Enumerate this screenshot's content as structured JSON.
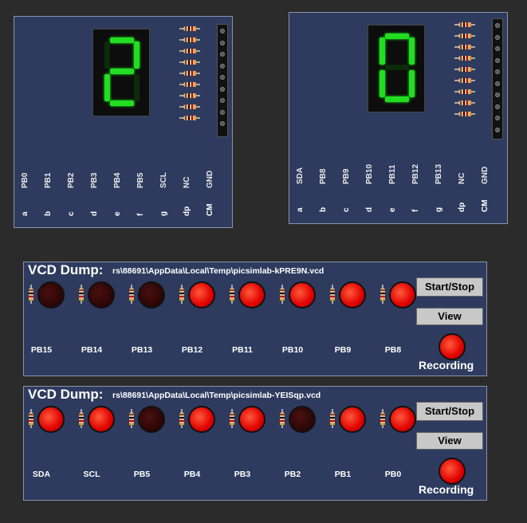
{
  "board1": {
    "digit": "2",
    "segments_on": [
      "a",
      "b",
      "g",
      "e",
      "d"
    ],
    "pin_letters": [
      "a",
      "b",
      "c",
      "d",
      "e",
      "f",
      "g",
      "dp",
      "CM"
    ],
    "pin_names": [
      "PB0",
      "PB1",
      "PB2",
      "PB3",
      "PB4",
      "PB5",
      "SCL",
      "NC",
      "GND"
    ]
  },
  "board2": {
    "digit": "0",
    "segments_on": [
      "a",
      "b",
      "c",
      "d",
      "e",
      "f"
    ],
    "pin_letters": [
      "a",
      "b",
      "c",
      "d",
      "e",
      "f",
      "g",
      "dp",
      "CM"
    ],
    "pin_names": [
      "SDA",
      "PB8",
      "PB9",
      "PB10",
      "PB11",
      "PB12",
      "PB13",
      "NC",
      "GND"
    ]
  },
  "vcd1": {
    "title": "VCD Dump:",
    "path": "rs\\88691\\AppData\\Local\\Temp\\picsimlab-kPRE9N.vcd",
    "leds": [
      {
        "label": "PB15",
        "on": false
      },
      {
        "label": "PB14",
        "on": false
      },
      {
        "label": "PB13",
        "on": false
      },
      {
        "label": "PB12",
        "on": true
      },
      {
        "label": "PB11",
        "on": true
      },
      {
        "label": "PB10",
        "on": true
      },
      {
        "label": "PB9",
        "on": true
      },
      {
        "label": "PB8",
        "on": true
      }
    ],
    "start_stop_label": "Start/Stop",
    "view_label": "View",
    "recording_label": "Recording"
  },
  "vcd2": {
    "title": "VCD Dump:",
    "path": "rs\\88691\\AppData\\Local\\Temp\\picsimlab-YEISqp.vcd",
    "leds": [
      {
        "label": "SDA",
        "on": true
      },
      {
        "label": "SCL",
        "on": true
      },
      {
        "label": "PB5",
        "on": false
      },
      {
        "label": "PB4",
        "on": true
      },
      {
        "label": "PB3",
        "on": true
      },
      {
        "label": "PB2",
        "on": false
      },
      {
        "label": "PB1",
        "on": true
      },
      {
        "label": "PB0",
        "on": true
      }
    ],
    "start_stop_label": "Start/Stop",
    "view_label": "View",
    "recording_label": "Recording"
  },
  "colors": {
    "board_bg": "#2e3b5e",
    "segment_on": "#22dd22",
    "led_on": "#e00000",
    "led_off": "#2a0505"
  }
}
